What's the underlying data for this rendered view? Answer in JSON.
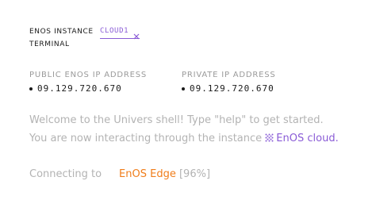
{
  "instance": {
    "label_line1": "ENOS INSTANCE",
    "label_line2": "TERMINAL",
    "active_tab": "CLOUD1"
  },
  "ips": {
    "public": {
      "header": "PUBLIC ENOS IP ADDRESS",
      "value": "09.129.720.670"
    },
    "private": {
      "header": "PRIVATE IP ADDRESS",
      "value": "09.129.720.670"
    }
  },
  "terminal": {
    "welcome": "Welcome to the Univers shell! Type \"help\" to get started.",
    "interacting_prefix": "You are now interacting through the instance",
    "cloud_name": "EnOS cloud",
    "interacting_suffix": ".",
    "connecting_label": "Connecting to",
    "edge_name": "EnOS Edge",
    "progress_text": "[96%]"
  },
  "colors": {
    "accent": "#8a5cd6",
    "edge": "#f07d1a",
    "muted": "#b3b3b3"
  },
  "icons": {
    "tab_close": "close-icon",
    "cloud": "grid-dots-icon"
  }
}
